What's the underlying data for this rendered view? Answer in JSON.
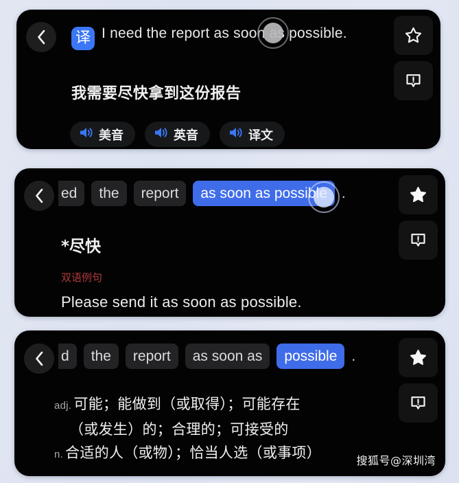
{
  "background_color": "#dfe4f1",
  "panel_color": "#030303",
  "accent_blue": "#3f6ce9",
  "badge_blue": "#3b76f6",
  "section_red": "#b1393c",
  "panels": [
    {
      "id": "translation-card",
      "back_label": "back",
      "translate_badge": "译",
      "source_text": "I need the report as soon as possible.",
      "translated_text": "我需要尽快拿到这份报告",
      "audio_buttons": [
        {
          "icon": "speaker-icon",
          "label": "美音"
        },
        {
          "icon": "speaker-icon",
          "label": "英音"
        },
        {
          "icon": "speaker-icon",
          "label": "译文"
        }
      ],
      "rail": [
        {
          "icon": "star-outline-icon",
          "name": "favorite-button",
          "state": "outline"
        },
        {
          "icon": "report-icon",
          "name": "report-button",
          "state": "outline"
        }
      ]
    },
    {
      "id": "phrase-lookup-card",
      "back_label": "back",
      "chips": [
        {
          "text": "ed",
          "selected": false,
          "clipped": true
        },
        {
          "text": "the",
          "selected": false,
          "clipped": false
        },
        {
          "text": "report",
          "selected": false,
          "clipped": false
        },
        {
          "text": "as soon as possible",
          "selected": true,
          "clipped": false
        }
      ],
      "trailing_punctuation": ".",
      "gloss": "*尽快",
      "section_title": "双语例句",
      "example_sentence": "Please send it as soon as possible.",
      "rail": [
        {
          "icon": "star-filled-icon",
          "name": "favorite-button",
          "state": "filled"
        },
        {
          "icon": "report-icon",
          "name": "report-button",
          "state": "outline"
        }
      ]
    },
    {
      "id": "word-lookup-card",
      "back_label": "back",
      "chips": [
        {
          "text": "d",
          "selected": false,
          "clipped": true
        },
        {
          "text": "the",
          "selected": false,
          "clipped": false
        },
        {
          "text": "report",
          "selected": false,
          "clipped": false
        },
        {
          "text": "as soon as",
          "selected": false,
          "clipped": false
        },
        {
          "text": "possible",
          "selected": true,
          "clipped": false
        }
      ],
      "trailing_punctuation": ".",
      "definitions": [
        {
          "pos": "adj.",
          "text": "可能；能做到（或取得）；可能存在"
        },
        {
          "pos": "",
          "text": "（或发生）的；合理的；可接受的"
        },
        {
          "pos": "n.",
          "text": "合适的人（或物）；恰当人选（或事项）"
        }
      ],
      "rail": [
        {
          "icon": "star-filled-icon",
          "name": "favorite-button",
          "state": "filled"
        },
        {
          "icon": "report-icon",
          "name": "report-button",
          "state": "outline"
        }
      ]
    }
  ],
  "watermark": "搜狐号@深圳湾"
}
